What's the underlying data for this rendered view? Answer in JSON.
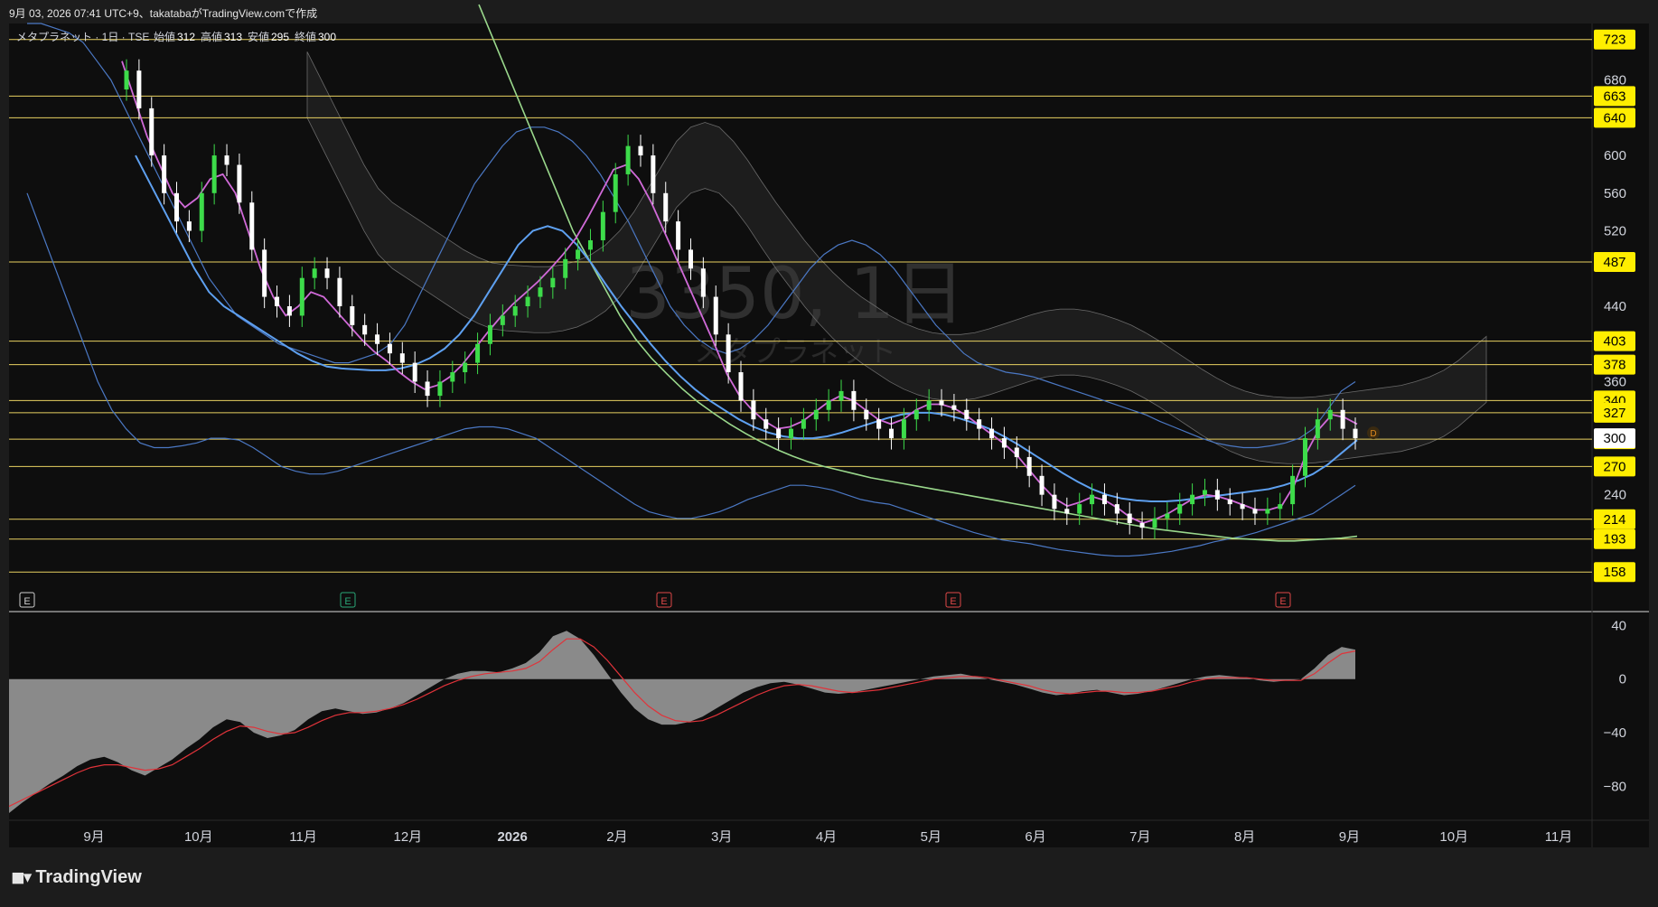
{
  "header": {
    "caption": "9月 03, 2026 07:41 UTC+9、takatabaがTradingView.comで作成",
    "symbol": "メタプラネット · 1日 · TSE",
    "open_label": "始値",
    "open": "312",
    "high_label": "高値",
    "high": "313",
    "low_label": "安値",
    "low": "295",
    "close_label": "終値",
    "close": "300"
  },
  "watermark": {
    "line1": "3350, 1日",
    "line2": "メタプラネット"
  },
  "footer": {
    "brand": "TradingView"
  },
  "colors": {
    "bg": "#0e0e0e",
    "up": "#3ddc4a",
    "down": "#ffffff",
    "hline": "#e8d060",
    "price_tag": "#ffee00",
    "bb": "#4b78c4",
    "ma_fast": "#d06ad8",
    "ma_mid": "#5ea0f0",
    "ma_slow": "#9ad88c",
    "macd_hist": "#8a8a8a",
    "macd_signal": "#e0333a"
  },
  "chart_data": [
    {
      "type": "candlestick",
      "x_ticks": [
        "9月",
        "10月",
        "11月",
        "12月",
        "2026",
        "2月",
        "3月",
        "4月",
        "5月",
        "6月",
        "7月",
        "8月",
        "9月",
        "10月",
        "11月"
      ],
      "y_ticks": [
        240,
        360,
        440,
        520,
        560,
        600,
        680
      ],
      "ylim": [
        140,
        740
      ],
      "price_levels": [
        723,
        663,
        640,
        487,
        403,
        378,
        340,
        327,
        299,
        270,
        214,
        193,
        158
      ],
      "last_price": 300,
      "earnings_markers": [
        "E",
        "E",
        "E",
        "E",
        "E"
      ],
      "series": [
        {
          "name": "close",
          "values": [
            690,
            650,
            600,
            560,
            530,
            520,
            560,
            600,
            590,
            550,
            500,
            450,
            440,
            430,
            470,
            480,
            470,
            440,
            420,
            410,
            400,
            390,
            380,
            360,
            345,
            360,
            370,
            380,
            400,
            420,
            430,
            440,
            450,
            460,
            470,
            490,
            500,
            510,
            540,
            580,
            610,
            600,
            560,
            530,
            500,
            480,
            450,
            410,
            370,
            340,
            320,
            310,
            300,
            310,
            320,
            330,
            340,
            350,
            330,
            320,
            310,
            300,
            320,
            330,
            340,
            335,
            330,
            320,
            310,
            300,
            290,
            280,
            260,
            240,
            225,
            220,
            230,
            240,
            230,
            220,
            210,
            205,
            215,
            220,
            230,
            240,
            245,
            235,
            230,
            225,
            220,
            225,
            230,
            260,
            300,
            320,
            330,
            310,
            300
          ]
        },
        {
          "name": "upper_bb",
          "values": [
            740,
            740,
            735,
            730,
            720,
            700,
            680,
            650,
            620,
            590,
            560,
            530,
            500,
            470,
            450,
            430,
            420,
            410,
            400,
            395,
            390,
            385,
            380,
            380,
            385,
            390,
            400,
            420,
            450,
            480,
            510,
            540,
            570,
            590,
            610,
            625,
            630,
            630,
            625,
            615,
            600,
            580,
            555,
            530,
            500,
            470,
            440,
            420,
            405,
            395,
            390,
            395,
            405,
            420,
            440,
            460,
            480,
            495,
            505,
            510,
            505,
            495,
            480,
            460,
            440,
            420,
            405,
            390,
            380,
            375,
            370,
            368,
            365,
            360,
            355,
            350,
            345,
            340,
            335,
            330,
            325,
            318,
            312,
            306,
            300,
            295,
            292,
            290,
            290,
            292,
            295,
            300,
            310,
            330,
            350,
            360
          ]
        },
        {
          "name": "lower_bb",
          "values": [
            560,
            520,
            480,
            440,
            400,
            360,
            330,
            310,
            295,
            290,
            290,
            292,
            295,
            300,
            300,
            298,
            290,
            280,
            270,
            265,
            262,
            262,
            265,
            270,
            275,
            280,
            285,
            290,
            295,
            300,
            305,
            310,
            312,
            312,
            310,
            305,
            300,
            290,
            280,
            270,
            260,
            250,
            240,
            230,
            222,
            218,
            215,
            215,
            218,
            222,
            228,
            235,
            240,
            245,
            250,
            250,
            248,
            245,
            240,
            235,
            232,
            230,
            225,
            220,
            215,
            210,
            205,
            200,
            196,
            192,
            190,
            188,
            185,
            182,
            180,
            178,
            176,
            175,
            175,
            176,
            178,
            180,
            183,
            186,
            190,
            193,
            196,
            200,
            205,
            210,
            215,
            220,
            230,
            240,
            250
          ]
        },
        {
          "name": "ma_fast",
          "values": [
            700,
            660,
            620,
            590,
            560,
            545,
            555,
            575,
            580,
            560,
            520,
            480,
            450,
            430,
            440,
            455,
            450,
            435,
            420,
            405,
            392,
            382,
            370,
            360,
            352,
            356,
            365,
            378,
            395,
            412,
            428,
            442,
            454,
            466,
            480,
            495,
            512,
            535,
            560,
            585,
            590,
            575,
            550,
            520,
            490,
            460,
            430,
            400,
            368,
            345,
            330,
            318,
            310,
            312,
            318,
            328,
            338,
            345,
            340,
            330,
            320,
            315,
            320,
            330,
            336,
            336,
            332,
            324,
            314,
            304,
            294,
            282,
            266,
            250,
            236,
            228,
            232,
            238,
            234,
            226,
            216,
            210,
            214,
            220,
            228,
            236,
            240,
            238,
            234,
            229,
            224,
            224,
            228,
            250,
            285,
            310,
            325,
            322,
            315
          ]
        },
        {
          "name": "ma_mid",
          "values": [
            600,
            570,
            540,
            510,
            480,
            455,
            440,
            430,
            420,
            410,
            400,
            390,
            382,
            376,
            374,
            373,
            372,
            372,
            374,
            378,
            385,
            395,
            410,
            430,
            455,
            480,
            505,
            520,
            525,
            520,
            505,
            485,
            462,
            440,
            420,
            400,
            382,
            366,
            352,
            340,
            330,
            320,
            312,
            306,
            302,
            300,
            300,
            302,
            306,
            311,
            316,
            321,
            325,
            327,
            327,
            325,
            321,
            316,
            310,
            302,
            293,
            283,
            273,
            263,
            254,
            246,
            240,
            236,
            234,
            233,
            233,
            234,
            236,
            238,
            240,
            242,
            244,
            246,
            250,
            255,
            262,
            272,
            285,
            298
          ]
        },
        {
          "name": "ma_slow",
          "values": [
            760,
            720,
            680,
            640,
            600,
            560,
            520,
            490,
            460,
            430,
            405,
            385,
            368,
            352,
            338,
            326,
            315,
            305,
            296,
            288,
            281,
            275,
            270,
            266,
            262,
            258,
            255,
            252,
            249,
            246,
            243,
            240,
            237,
            234,
            231,
            228,
            225,
            222,
            219,
            216,
            213,
            210,
            207,
            204,
            202,
            200,
            198,
            196,
            194,
            193,
            192,
            191,
            191,
            192,
            193,
            194,
            196
          ]
        }
      ]
    },
    {
      "type": "histogram",
      "name": "macd",
      "y_ticks": [
        40,
        0,
        -40,
        -80
      ],
      "ylim": [
        -100,
        45
      ],
      "series": [
        {
          "name": "histogram",
          "values": [
            -100,
            -92,
            -85,
            -78,
            -72,
            -65,
            -60,
            -58,
            -62,
            -68,
            -72,
            -66,
            -60,
            -52,
            -45,
            -36,
            -30,
            -32,
            -40,
            -44,
            -42,
            -38,
            -30,
            -24,
            -22,
            -24,
            -26,
            -25,
            -22,
            -18,
            -12,
            -6,
            0,
            4,
            6,
            6,
            5,
            8,
            12,
            20,
            32,
            36,
            30,
            18,
            4,
            -10,
            -22,
            -30,
            -34,
            -34,
            -32,
            -28,
            -22,
            -16,
            -10,
            -6,
            -3,
            -2,
            -4,
            -7,
            -10,
            -11,
            -10,
            -8,
            -6,
            -4,
            -2,
            0,
            2,
            3,
            4,
            2,
            0,
            -2,
            -4,
            -7,
            -10,
            -12,
            -11,
            -9,
            -8,
            -10,
            -12,
            -11,
            -9,
            -6,
            -3,
            0,
            2,
            3,
            2,
            1,
            -1,
            -2,
            -1,
            0,
            8,
            18,
            24,
            22
          ]
        },
        {
          "name": "signal",
          "values": [
            -95,
            -90,
            -85,
            -80,
            -75,
            -70,
            -66,
            -64,
            -64,
            -66,
            -68,
            -67,
            -64,
            -58,
            -52,
            -45,
            -39,
            -35,
            -36,
            -39,
            -41,
            -40,
            -36,
            -31,
            -27,
            -25,
            -25,
            -24,
            -22,
            -19,
            -15,
            -10,
            -5,
            -1,
            2,
            4,
            5,
            6,
            8,
            13,
            22,
            30,
            30,
            24,
            14,
            2,
            -10,
            -20,
            -27,
            -31,
            -32,
            -31,
            -27,
            -22,
            -17,
            -12,
            -8,
            -5,
            -4,
            -5,
            -7,
            -9,
            -10,
            -9,
            -8,
            -6,
            -4,
            -2,
            0,
            1,
            2,
            2,
            1,
            -1,
            -3,
            -5,
            -8,
            -10,
            -11,
            -10,
            -9,
            -9,
            -10,
            -10,
            -9,
            -7,
            -5,
            -2,
            0,
            1,
            1,
            1,
            0,
            -1,
            -1,
            -1,
            4,
            12,
            19,
            21
          ]
        }
      ]
    }
  ]
}
